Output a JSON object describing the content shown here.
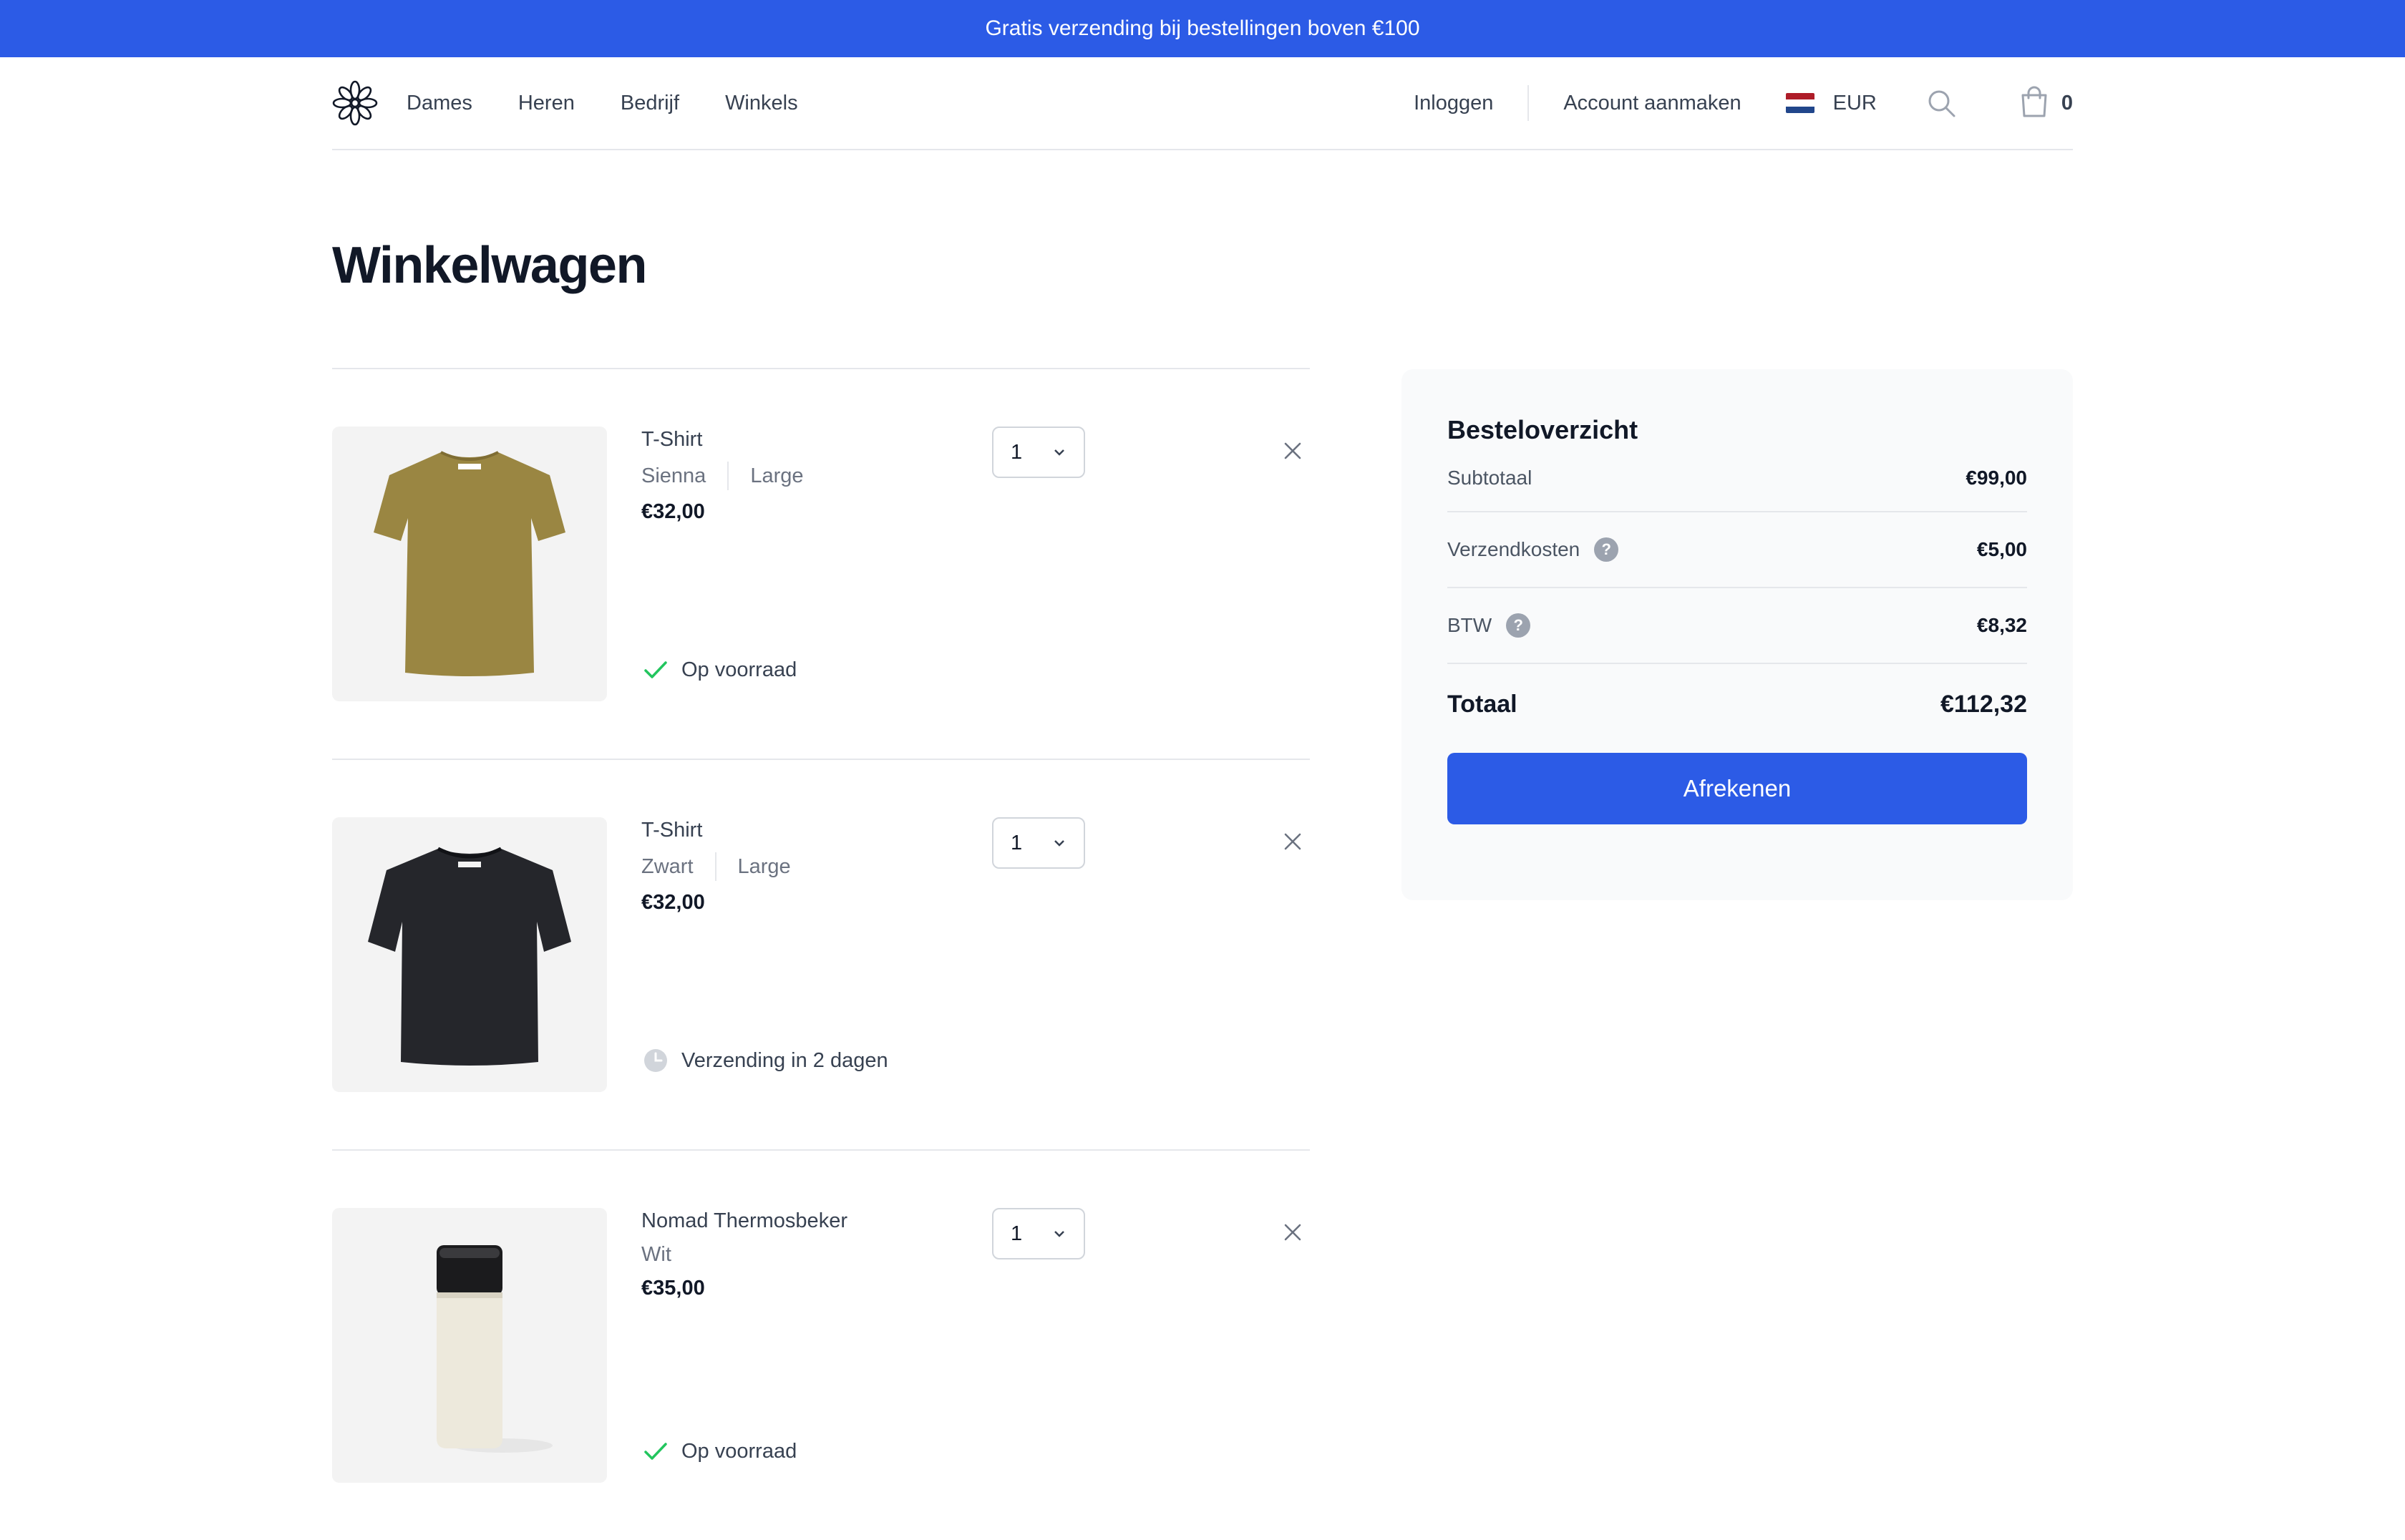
{
  "promo": {
    "text": "Gratis verzending bij bestellingen boven €100"
  },
  "header": {
    "nav": [
      "Dames",
      "Heren",
      "Bedrijf",
      "Winkels"
    ],
    "login": "Inloggen",
    "signup": "Account aanmaken",
    "currency": "EUR",
    "cart_count": "0",
    "icons": {
      "logo": "flower-logo-icon",
      "search": "search-icon",
      "cart": "shopping-bag-icon"
    }
  },
  "page": {
    "title": "Winkelwagen"
  },
  "cart": {
    "items": [
      {
        "name": "T-Shirt",
        "color": "Sienna",
        "size": "Large",
        "price": "€32,00",
        "quantity": "1",
        "status": "Op voorraad",
        "status_icon": "check-icon",
        "image_icon": "tshirt-image"
      },
      {
        "name": "T-Shirt",
        "color": "Zwart",
        "size": "Large",
        "price": "€32,00",
        "quantity": "1",
        "status": "Verzending in 2 dagen",
        "status_icon": "clock-icon",
        "image_icon": "tshirt-image"
      },
      {
        "name": "Nomad Thermosbeker",
        "color": "Wit",
        "size": "",
        "price": "€35,00",
        "quantity": "1",
        "status": "Op voorraad",
        "status_icon": "check-icon",
        "image_icon": "thermos-image"
      }
    ]
  },
  "summary": {
    "title": "Besteloverzicht",
    "subtotal_label": "Subtotaal",
    "subtotal": "€99,00",
    "shipping_label": "Verzendkosten",
    "shipping": "€5,00",
    "tax_label": "BTW",
    "tax": "€8,32",
    "total_label": "Totaal",
    "total": "€112,32",
    "checkout_label": "Afrekenen"
  },
  "colors": {
    "accent": "#2c5be6",
    "success": "#22c55e",
    "tshirt_sienna": "#9a8642",
    "tshirt_black": "#25262b",
    "thermos_body": "#ede9dc",
    "flag_red": "#ae1c28",
    "flag_white": "#ffffff",
    "flag_blue": "#21468b"
  }
}
